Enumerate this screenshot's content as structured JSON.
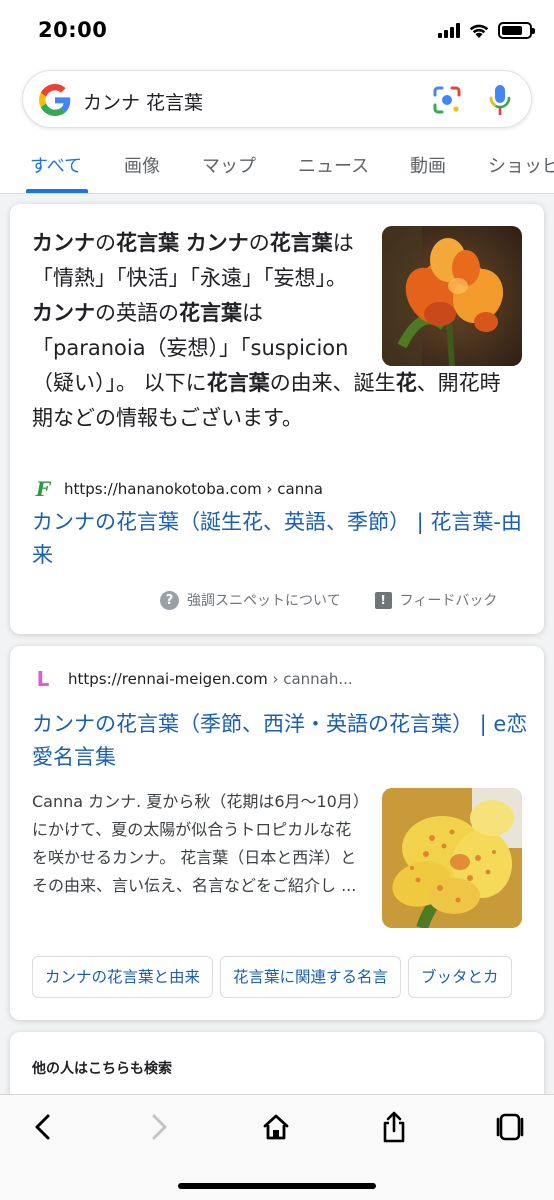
{
  "status_bar": {
    "time": "20:00",
    "battery_level": 0.75
  },
  "search": {
    "query": "カンナ 花言葉",
    "logo": "google-g-icon",
    "lens": "google-lens-icon",
    "mic": "microphone-icon"
  },
  "tabs": [
    {
      "label": "すべて",
      "active": true
    },
    {
      "label": "画像"
    },
    {
      "label": "マップ"
    },
    {
      "label": "ニュース"
    },
    {
      "label": "動画"
    },
    {
      "label": "ショッピ"
    }
  ],
  "featured_snippet": {
    "segments": [
      {
        "text": "カンナ",
        "bold": true
      },
      {
        "text": "の",
        "bold": false
      },
      {
        "text": "花言葉",
        "bold": true
      },
      {
        "text": " ",
        "bold": false
      },
      {
        "text": "カンナ",
        "bold": true
      },
      {
        "text": "の",
        "bold": false
      },
      {
        "text": "花言葉",
        "bold": true
      },
      {
        "text": "は「情熱」「快活」「永遠」「妄想」。 ",
        "bold": false
      },
      {
        "text": "カンナ",
        "bold": true
      },
      {
        "text": "の英語の",
        "bold": false
      },
      {
        "text": "花言葉",
        "bold": true
      },
      {
        "text": "は「paranoia（妄想）」「suspicion（疑い）」。 以下に",
        "bold": false
      },
      {
        "text": "花言葉",
        "bold": true
      },
      {
        "text": "の由来、誕生",
        "bold": false
      },
      {
        "text": "花",
        "bold": true
      },
      {
        "text": "、開花時期などの情報もございます。",
        "bold": false
      }
    ],
    "image": "orange-canna-flower-photo",
    "favicon": "F",
    "site": "https://hananokotoba.com",
    "breadcrumb": " › canna",
    "title": "カンナの花言葉（誕生花、英語、季節） | 花言葉-由来",
    "about_label": "強調スニペットについて",
    "feedback_label": "フィードバック"
  },
  "result2": {
    "favicon": "L",
    "site": "https://rennai-meigen.com",
    "breadcrumb": " › cannah...",
    "title": "カンナの花言葉（季節、西洋・英語の花言葉） | e恋愛名言集",
    "description": "Canna カンナ. 夏から秋（花期は6月〜10月）にかけて、夏の太陽が似合うトロピカルな花を咲かせるカンナ。 花言葉（日本と西洋）とその由来、言い伝え、名言などをご紹介し ...",
    "image": "yellow-spotted-canna-flower-photo",
    "chips": [
      "カンナの花言葉と由来",
      "花言葉に関連する名言",
      "ブッタとカ"
    ]
  },
  "people_also_search": {
    "title": "他の人はこちらも検索"
  },
  "bottom_nav": {
    "back": "chevron-left-icon",
    "forward": "chevron-right-icon",
    "home": "home-icon",
    "share": "share-icon",
    "tabs": "tabs-icon"
  },
  "colors": {
    "link": "#1a5fb4",
    "accent": "#1a73e8",
    "background": "#f1f3f4"
  }
}
